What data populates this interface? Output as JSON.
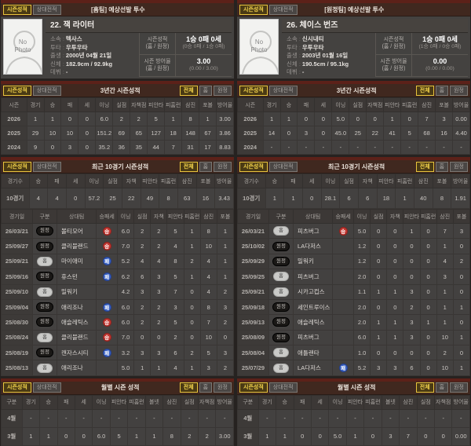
{
  "ui": {
    "tabs": {
      "season": "시즌성적",
      "h2h": "상대전적"
    },
    "filters": {
      "all": "전체",
      "home": "홈",
      "away": "원정"
    },
    "badges": {
      "win": "승",
      "lose": "패",
      "home": "홈",
      "away": "원정"
    },
    "colors": {
      "accent": "#f4d44c",
      "win_badge": "#c43a34",
      "lose_badge": "#3a62c4",
      "section_band": "#5c2119",
      "background": "#262220"
    }
  },
  "panels": [
    {
      "header_title": "[홈팀] 예상선발 투수",
      "player": {
        "name": "22. 잭 라이터",
        "photo_text_line1": "No",
        "photo_text_line2": "Photo",
        "info": [
          {
            "label": "소속",
            "value": "텍사스"
          },
          {
            "label": "투타",
            "value": "우투우타"
          },
          {
            "label": "출생",
            "value": "2000년 04월 21일"
          },
          {
            "label": "신체",
            "value": "182.9cm / 92.9kg"
          },
          {
            "label": "데뷔",
            "value": "-"
          }
        ],
        "season_record": {
          "label": "시즌성적",
          "sublabel": "(홈 / 원정)",
          "value": "1승 0패 0세",
          "subvalue": "(0승 0패 / 1승 0패)"
        },
        "season_era": {
          "label": "시즌 방어율",
          "sublabel": "(홈 / 원정)",
          "value": "3.00",
          "subvalue": "(0.00 / 3.00)"
        }
      },
      "three_year": {
        "title": "3년간 시즌성적",
        "headers": [
          "시즌",
          "경기",
          "승",
          "패",
          "세",
          "이닝",
          "실점",
          "자책점",
          "피안타",
          "피홈런",
          "삼진",
          "포볼",
          "방어율"
        ],
        "rows": [
          [
            "2026",
            "1",
            "1",
            "0",
            "0",
            "6.0",
            "2",
            "2",
            "5",
            "1",
            "8",
            "1",
            "3.00"
          ],
          [
            "2025",
            "29",
            "10",
            "10",
            "0",
            "151.2",
            "69",
            "65",
            "127",
            "18",
            "148",
            "67",
            "3.86"
          ],
          [
            "2024",
            "9",
            "0",
            "3",
            "0",
            "35.2",
            "36",
            "35",
            "44",
            "7",
            "31",
            "17",
            "8.83"
          ]
        ]
      },
      "recent10": {
        "title": "최근 10경기 시즌성적",
        "summary_headers": [
          "경기수",
          "승",
          "패",
          "세",
          "이닝",
          "실점",
          "자책",
          "피안타",
          "피홈런",
          "삼진",
          "포볼",
          "방어율"
        ],
        "summary_row": [
          "10경기",
          "4",
          "4",
          "0",
          "57.2",
          "25",
          "22",
          "49",
          "8",
          "63",
          "16",
          "3.43"
        ],
        "game_headers": [
          "경기일",
          "구분",
          "상대팀",
          "승패세",
          "이닝",
          "실점",
          "자책",
          "피안타",
          "피홈런",
          "삼진",
          "포볼"
        ],
        "games": [
          {
            "date": "26/03/21",
            "venue": "away",
            "opponent": "볼티모어",
            "result": "win",
            "stats": [
              "6.0",
              "2",
              "2",
              "5",
              "1",
              "8",
              "1"
            ]
          },
          {
            "date": "25/09/27",
            "venue": "away",
            "opponent": "클리블랜드",
            "result": "win",
            "stats": [
              "7.0",
              "2",
              "2",
              "4",
              "1",
              "10",
              "1"
            ]
          },
          {
            "date": "25/09/21",
            "venue": "home",
            "opponent": "마이애미",
            "result": "lose",
            "stats": [
              "5.2",
              "4",
              "4",
              "8",
              "2",
              "4",
              "1"
            ]
          },
          {
            "date": "25/09/16",
            "venue": "away",
            "opponent": "휴스턴",
            "result": "lose",
            "stats": [
              "6.2",
              "6",
              "3",
              "5",
              "1",
              "4",
              "1"
            ]
          },
          {
            "date": "25/09/10",
            "venue": "home",
            "opponent": "밀워키",
            "result": "",
            "stats": [
              "4.2",
              "3",
              "3",
              "7",
              "0",
              "4",
              "2"
            ]
          },
          {
            "date": "25/09/04",
            "venue": "away",
            "opponent": "애리조나",
            "result": "lose",
            "stats": [
              "6.0",
              "2",
              "2",
              "3",
              "0",
              "8",
              "3"
            ]
          },
          {
            "date": "25/08/30",
            "venue": "away",
            "opponent": "애슬레틱스",
            "result": "win",
            "stats": [
              "6.0",
              "2",
              "2",
              "5",
              "0",
              "7",
              "2"
            ]
          },
          {
            "date": "25/08/24",
            "venue": "home",
            "opponent": "클리블랜드",
            "result": "win",
            "stats": [
              "7.0",
              "0",
              "0",
              "2",
              "0",
              "10",
              "0"
            ]
          },
          {
            "date": "25/08/19",
            "venue": "away",
            "opponent": "캔자스시티",
            "result": "lose",
            "stats": [
              "3.2",
              "3",
              "3",
              "6",
              "2",
              "5",
              "3"
            ]
          },
          {
            "date": "25/08/13",
            "venue": "home",
            "opponent": "애리조나",
            "result": "",
            "stats": [
              "5.0",
              "1",
              "1",
              "4",
              "1",
              "3",
              "2"
            ]
          }
        ]
      },
      "monthly": {
        "title": "월별 시즌 성적",
        "headers": [
          "구분",
          "경기",
          "승",
          "패",
          "세",
          "이닝",
          "피안타",
          "피홈런",
          "볼넷",
          "삼진",
          "실점",
          "자책점",
          "방어율"
        ],
        "rows": [
          [
            "4월",
            "-",
            "-",
            "-",
            "-",
            "-",
            "-",
            "-",
            "-",
            "-",
            "-",
            "-",
            "-"
          ],
          [
            "3월",
            "1",
            "1",
            "0",
            "0",
            "6.0",
            "5",
            "1",
            "1",
            "8",
            "2",
            "2",
            "3.00"
          ]
        ]
      }
    },
    {
      "header_title": "[원정팀] 예상선발 투수",
      "player": {
        "name": "26. 체이스 번즈",
        "photo_text_line1": "No",
        "photo_text_line2": "Photo",
        "info": [
          {
            "label": "소속",
            "value": "신시내티"
          },
          {
            "label": "투타",
            "value": "우투우타"
          },
          {
            "label": "출생",
            "value": "2003년 01월 16일"
          },
          {
            "label": "신체",
            "value": "190.5cm / 95.1kg"
          },
          {
            "label": "데뷔",
            "value": "-"
          }
        ],
        "season_record": {
          "label": "시즌성적",
          "sublabel": "(홈 / 원정)",
          "value": "1승 0패 0세",
          "subvalue": "(1승 0패 / 0승 0패)"
        },
        "season_era": {
          "label": "시즌 방어율",
          "sublabel": "(홈 / 원정)",
          "value": "0.00",
          "subvalue": "(0.00 / 0.00)"
        }
      },
      "three_year": {
        "title": "3년간 시즌성적",
        "headers": [
          "시즌",
          "경기",
          "승",
          "패",
          "세",
          "이닝",
          "실점",
          "자책점",
          "피안타",
          "피홈런",
          "삼진",
          "포볼",
          "방어율"
        ],
        "rows": [
          [
            "2026",
            "1",
            "1",
            "0",
            "0",
            "5.0",
            "0",
            "0",
            "1",
            "0",
            "7",
            "3",
            "0.00"
          ],
          [
            "2025",
            "14",
            "0",
            "3",
            "0",
            "45.0",
            "25",
            "22",
            "41",
            "5",
            "68",
            "16",
            "4.40"
          ],
          [
            "2024",
            "-",
            "-",
            "-",
            "-",
            "-",
            "-",
            "-",
            "-",
            "-",
            "-",
            "-",
            "-"
          ]
        ]
      },
      "recent10": {
        "title": "최근 10경기 시즌성적",
        "summary_headers": [
          "경기수",
          "승",
          "패",
          "세",
          "이닝",
          "실점",
          "자책",
          "피안타",
          "피홈런",
          "삼진",
          "포볼",
          "방어율"
        ],
        "summary_row": [
          "10경기",
          "1",
          "1",
          "0",
          "28.1",
          "6",
          "6",
          "18",
          "1",
          "40",
          "8",
          "1.91"
        ],
        "game_headers": [
          "경기일",
          "구분",
          "상대팀",
          "승패세",
          "이닝",
          "실점",
          "자책",
          "피안타",
          "피홈런",
          "삼진",
          "포볼"
        ],
        "games": [
          {
            "date": "26/03/21",
            "venue": "home",
            "opponent": "피츠버그",
            "result": "win",
            "stats": [
              "5.0",
              "0",
              "0",
              "1",
              "0",
              "7",
              "3"
            ]
          },
          {
            "date": "25/10/02",
            "venue": "away",
            "opponent": "LA다저스",
            "result": "",
            "stats": [
              "1.2",
              "0",
              "0",
              "0",
              "0",
              "1",
              "0"
            ]
          },
          {
            "date": "25/09/29",
            "venue": "away",
            "opponent": "밀워키",
            "result": "",
            "stats": [
              "1.2",
              "0",
              "0",
              "0",
              "0",
              "4",
              "2"
            ]
          },
          {
            "date": "25/09/25",
            "venue": "home",
            "opponent": "피츠버그",
            "result": "",
            "stats": [
              "2.0",
              "0",
              "0",
              "0",
              "0",
              "3",
              "0"
            ]
          },
          {
            "date": "25/09/21",
            "venue": "home",
            "opponent": "시카고컵스",
            "result": "",
            "stats": [
              "1.1",
              "1",
              "1",
              "3",
              "0",
              "1",
              "0"
            ]
          },
          {
            "date": "25/09/18",
            "venue": "away",
            "opponent": "세인트루이스",
            "result": "",
            "stats": [
              "2.0",
              "0",
              "0",
              "2",
              "0",
              "1",
              "1"
            ]
          },
          {
            "date": "25/09/13",
            "venue": "away",
            "opponent": "애슬레틱스",
            "result": "",
            "stats": [
              "2.0",
              "1",
              "1",
              "3",
              "1",
              "1",
              "0"
            ]
          },
          {
            "date": "25/08/09",
            "venue": "away",
            "opponent": "피츠버그",
            "result": "",
            "stats": [
              "6.0",
              "1",
              "1",
              "3",
              "0",
              "10",
              "1"
            ]
          },
          {
            "date": "25/08/04",
            "venue": "home",
            "opponent": "애틀랜타",
            "result": "",
            "stats": [
              "1.0",
              "0",
              "0",
              "0",
              "0",
              "2",
              "0"
            ]
          },
          {
            "date": "25/07/29",
            "venue": "home",
            "opponent": "LA다저스",
            "result": "lose",
            "stats": [
              "5.2",
              "3",
              "3",
              "6",
              "0",
              "10",
              "1"
            ]
          }
        ]
      },
      "monthly": {
        "title": "월별 시즌 성적",
        "headers": [
          "구분",
          "경기",
          "승",
          "패",
          "세",
          "이닝",
          "피안타",
          "피홈런",
          "볼넷",
          "삼진",
          "실점",
          "자책점",
          "방어율"
        ],
        "rows": [
          [
            "4월",
            "-",
            "-",
            "-",
            "-",
            "-",
            "-",
            "-",
            "-",
            "-",
            "-",
            "-",
            "-"
          ],
          [
            "3월",
            "1",
            "1",
            "0",
            "0",
            "5.0",
            "1",
            "0",
            "3",
            "7",
            "0",
            "0",
            "0.00"
          ]
        ]
      }
    }
  ]
}
